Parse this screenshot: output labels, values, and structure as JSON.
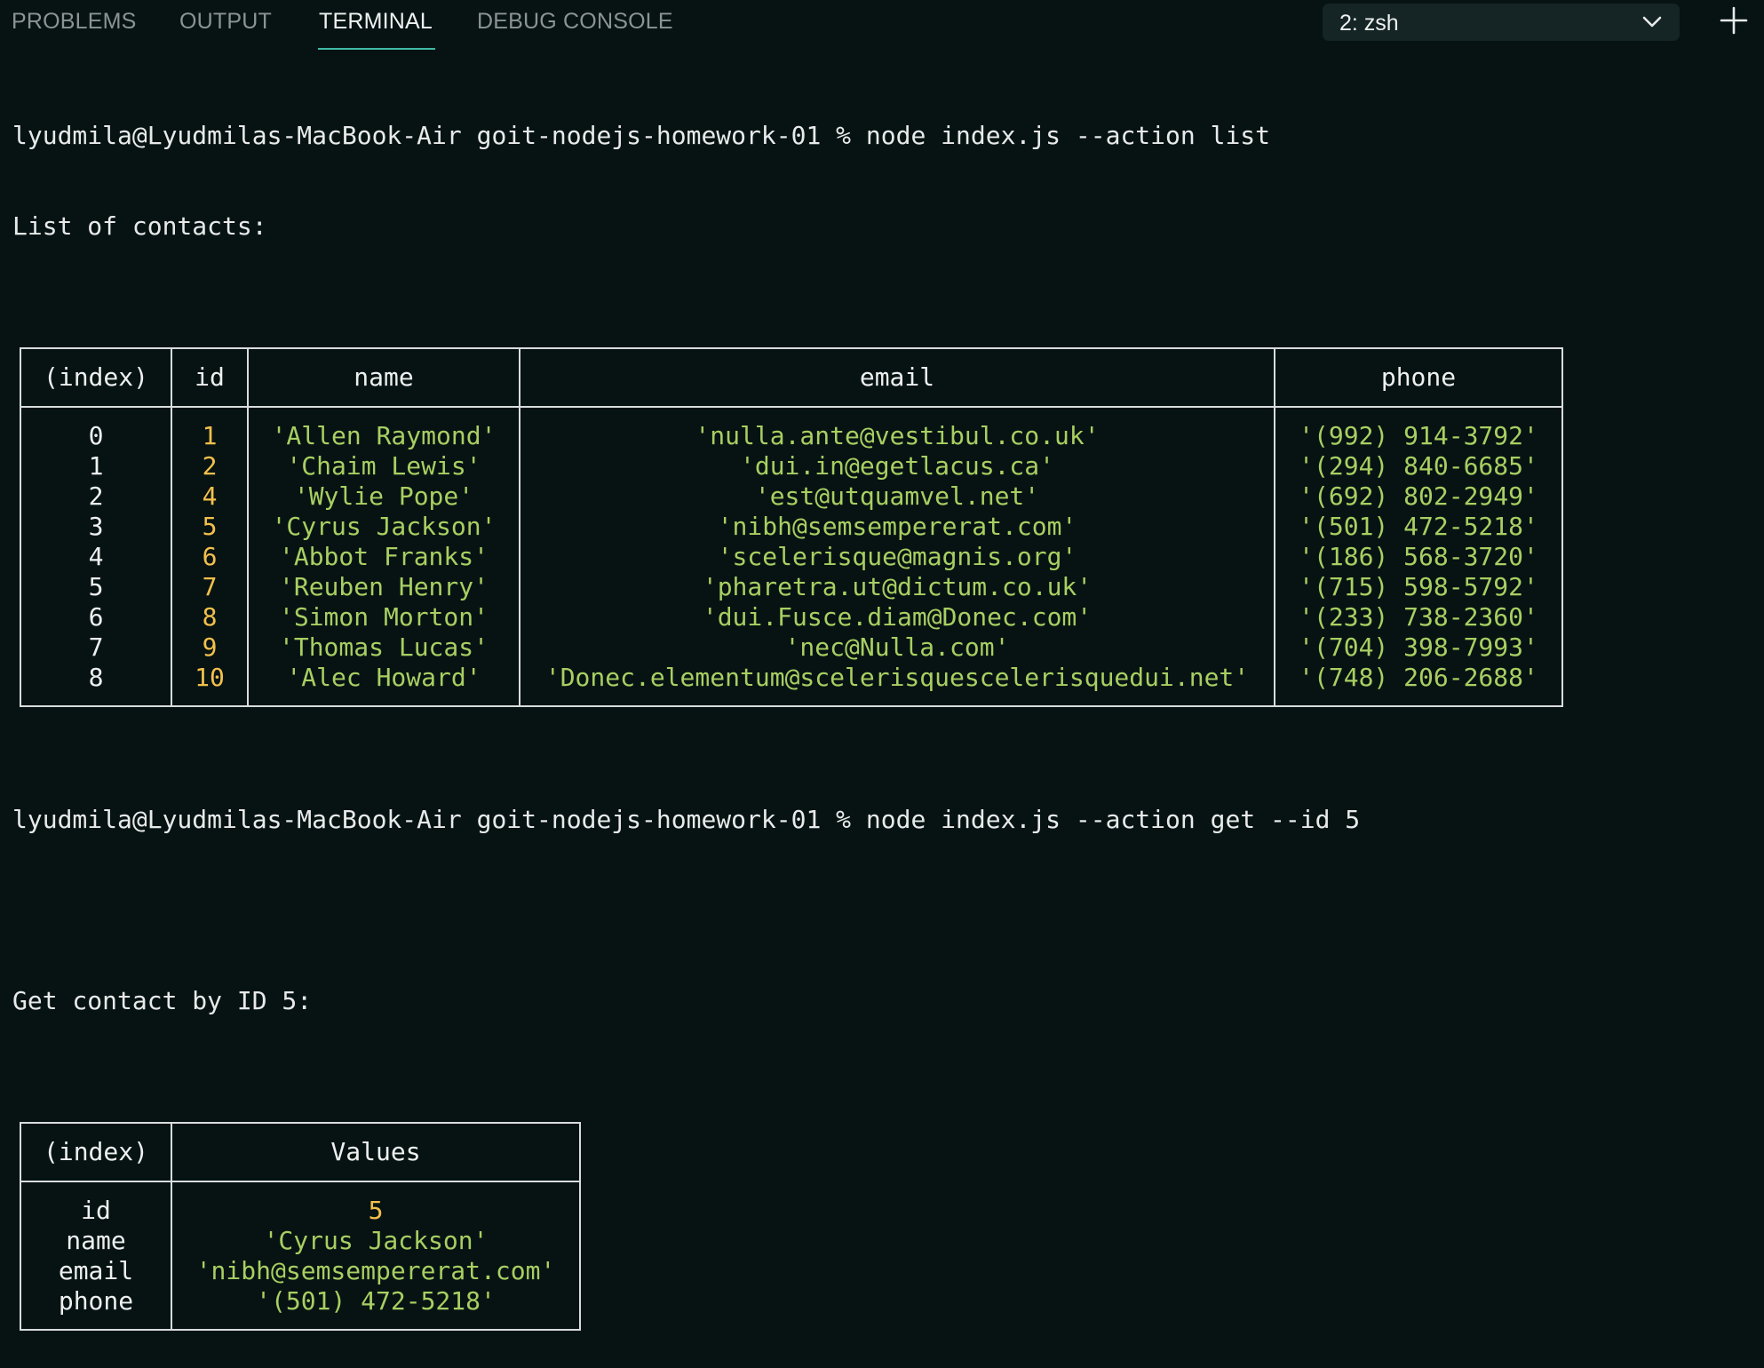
{
  "tabs": [
    "PROBLEMS",
    "OUTPUT",
    "TERMINAL",
    "DEBUG CONSOLE"
  ],
  "active_tab": "TERMINAL",
  "shell_selector": {
    "value": "2: zsh"
  },
  "colors": {
    "background": "#071313",
    "number": "#f3c04b",
    "string": "#a8cf62",
    "accent": "#3fb9a4"
  },
  "terminal": {
    "cmd1": "lyudmila@Lyudmilas-MacBook-Air goit-nodejs-homework-01 % node index.js --action list",
    "out1": "List of contacts:",
    "contacts_table": {
      "headers": [
        "(index)",
        "id",
        "name",
        "email",
        "phone"
      ],
      "rows": [
        [
          "0",
          "1",
          "'Allen Raymond'",
          "'nulla.ante@vestibul.co.uk'",
          "'(992) 914-3792'"
        ],
        [
          "1",
          "2",
          "'Chaim Lewis'",
          "'dui.in@egetlacus.ca'",
          "'(294) 840-6685'"
        ],
        [
          "2",
          "4",
          "'Wylie Pope'",
          "'est@utquamvel.net'",
          "'(692) 802-2949'"
        ],
        [
          "3",
          "5",
          "'Cyrus Jackson'",
          "'nibh@semsempererat.com'",
          "'(501) 472-5218'"
        ],
        [
          "4",
          "6",
          "'Abbot Franks'",
          "'scelerisque@magnis.org'",
          "'(186) 568-3720'"
        ],
        [
          "5",
          "7",
          "'Reuben Henry'",
          "'pharetra.ut@dictum.co.uk'",
          "'(715) 598-5792'"
        ],
        [
          "6",
          "8",
          "'Simon Morton'",
          "'dui.Fusce.diam@Donec.com'",
          "'(233) 738-2360'"
        ],
        [
          "7",
          "9",
          "'Thomas Lucas'",
          "'nec@Nulla.com'",
          "'(704) 398-7993'"
        ],
        [
          "8",
          "10",
          "'Alec Howard'",
          "'Donec.elementum@scelerisquescelerisquedui.net'",
          "'(748) 206-2688'"
        ]
      ]
    },
    "cmd2": "lyudmila@Lyudmilas-MacBook-Air goit-nodejs-homework-01 % node index.js --action get --id 5",
    "out2": "Get contact by ID 5:",
    "contact_table": {
      "headers": [
        "(index)",
        "Values"
      ],
      "rows": [
        [
          "id",
          "5"
        ],
        [
          "name",
          "'Cyrus Jackson'"
        ],
        [
          "email",
          "'nibh@semsempererat.com'"
        ],
        [
          "phone",
          "'(501) 472-5218'"
        ]
      ]
    }
  }
}
